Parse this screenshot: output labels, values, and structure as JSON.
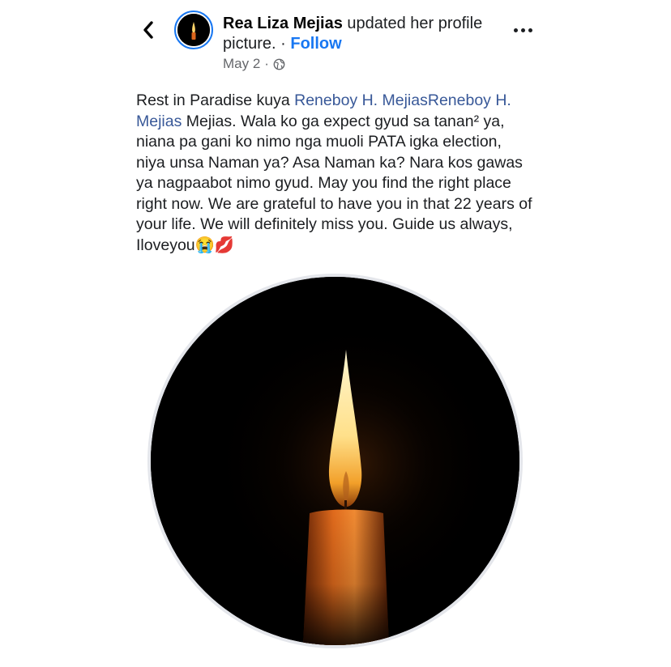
{
  "post": {
    "author": "Rea Liza Mejias",
    "action": " updated her profile picture.",
    "separator": " · ",
    "follow_label": "Follow",
    "date": "May 2",
    "dot": " · ",
    "audience_icon": "globe-icon",
    "caption": {
      "intro": "Rest in Paradise kuya ",
      "mention_1": "Reneboy H. Mejias",
      "mention_2": "Reneboy H. Mejias",
      "body": " Mejias. Wala ko ga expect gyud sa tanan² ya, niana pa gani ko nimo nga muoli PATA igka election, niya unsa Naman ya? Asa Naman ka? Nara kos gawas ya nagpaabot nimo gyud. May you find the right place right now. We are grateful to have you in that 22 years of your life. We will definitely miss you. Guide us always, Iloveyou",
      "emoji": "😭💋"
    }
  },
  "icons": {
    "back": "chevron-left-icon",
    "more": "more-horizontal-icon",
    "photo": "candle-photo"
  },
  "colors": {
    "link": "#385898",
    "follow": "#1877f2",
    "meta": "#65676b"
  }
}
